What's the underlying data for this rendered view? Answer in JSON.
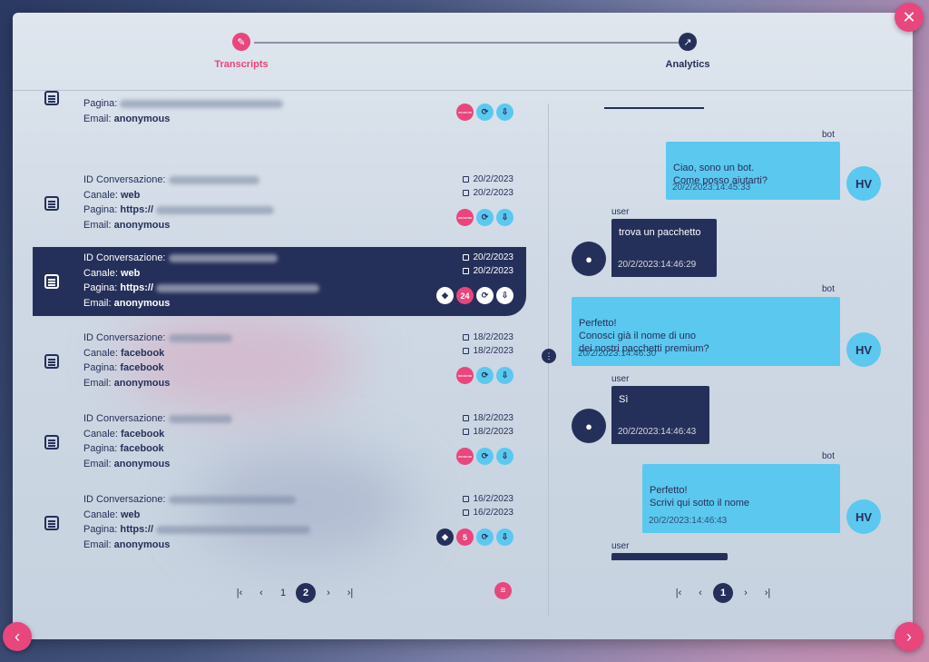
{
  "steps": [
    {
      "label": "Transcripts",
      "active": true,
      "icon": "pencil-icon"
    },
    {
      "label": "Analytics",
      "active": false,
      "icon": "chart-icon"
    }
  ],
  "conversations": [
    {
      "id_label": "",
      "canale_label": "",
      "canale": "",
      "pagina_label": "Pagina:",
      "pagina": "",
      "email_label": "Email:",
      "email": "anonymous",
      "date1": "",
      "date2": "",
      "badge": ""
    },
    {
      "id_label": "ID Conversazione:",
      "canale_label": "Canale:",
      "canale": "web",
      "pagina_label": "Pagina:",
      "pagina": "https://",
      "email_label": "Email:",
      "email": "anonymous",
      "date1": "20/2/2023",
      "date2": "20/2/2023",
      "badge": ""
    },
    {
      "id_label": "ID Conversazione:",
      "canale_label": "Canale:",
      "canale": "web",
      "pagina_label": "Pagina:",
      "pagina": "https://",
      "email_label": "Email:",
      "email": "anonymous",
      "date1": "20/2/2023",
      "date2": "20/2/2023",
      "badge": "24"
    },
    {
      "id_label": "ID Conversazione:",
      "canale_label": "Canale:",
      "canale": "facebook",
      "pagina_label": "Pagina:",
      "pagina": "facebook",
      "email_label": "Email:",
      "email": "anonymous",
      "date1": "18/2/2023",
      "date2": "18/2/2023",
      "badge": ""
    },
    {
      "id_label": "ID Conversazione:",
      "canale_label": "Canale:",
      "canale": "facebook",
      "pagina_label": "Pagina:",
      "pagina": "facebook",
      "email_label": "Email:",
      "email": "anonymous",
      "date1": "18/2/2023",
      "date2": "18/2/2023",
      "badge": ""
    },
    {
      "id_label": "ID Conversazione:",
      "canale_label": "Canale:",
      "canale": "web",
      "pagina_label": "Pagina:",
      "pagina": "https://",
      "email_label": "Email:",
      "email": "anonymous",
      "date1": "16/2/2023",
      "date2": "16/2/2023",
      "badge": "5"
    }
  ],
  "left_pager": {
    "first": "|‹",
    "prev": "‹",
    "pages": [
      "1",
      "2"
    ],
    "current": "2",
    "next": "›",
    "last": "›|"
  },
  "right_pager": {
    "first": "|‹",
    "prev": "‹",
    "pages": [
      "1"
    ],
    "current": "1",
    "next": "›",
    "last": "›|"
  },
  "chat": [
    {
      "sender": "bot",
      "text": "Ciao, sono un bot.\nCome posso aiutarti?",
      "time": "20/2/2023:14:45:33",
      "avatar": "HV"
    },
    {
      "sender": "user",
      "text": "trova un pacchetto",
      "time": "20/2/2023:14:46:29"
    },
    {
      "sender": "bot",
      "text": "Perfetto!\nConosci già il nome di uno\ndei nostri pacchetti premium?",
      "time": "20/2/2023:14:46:30",
      "avatar": "HV"
    },
    {
      "sender": "user",
      "text": "Sì",
      "time": "20/2/2023:14:46:43"
    },
    {
      "sender": "bot",
      "text": "Perfetto!\nScrivi qui sotto il nome",
      "time": "20/2/2023:14:46:43",
      "avatar": "HV"
    },
    {
      "sender": "user",
      "text": "",
      "time": ""
    }
  ],
  "colors": {
    "accent": "#e8467c",
    "navy": "#25305a",
    "bot_bubble": "#5bc8ef"
  }
}
